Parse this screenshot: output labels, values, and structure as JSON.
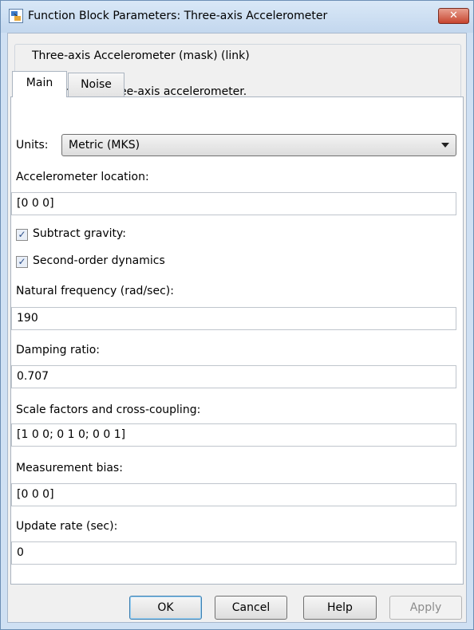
{
  "window": {
    "title": "Function Block Parameters: Three-axis Accelerometer",
    "close_label": "✕"
  },
  "block": {
    "header": "Three-axis Accelerometer (mask) (link)",
    "description": "Implement a three-axis accelerometer."
  },
  "tabs": [
    {
      "label": "Main",
      "active": true
    },
    {
      "label": "Noise",
      "active": false
    }
  ],
  "main": {
    "units_label": "Units:",
    "units_value": "Metric (MKS)",
    "accel_location_label": "Accelerometer location:",
    "accel_location_value": "[0 0 0]",
    "subtract_gravity_label": "Subtract gravity:",
    "subtract_gravity_checked": true,
    "second_order_label": "Second-order dynamics",
    "second_order_checked": true,
    "natural_freq_label": "Natural frequency (rad/sec):",
    "natural_freq_value": "190",
    "damping_label": "Damping ratio:",
    "damping_value": "0.707",
    "scale_label": "Scale factors and cross-coupling:",
    "scale_value": "[1 0 0; 0 1 0; 0 0 1]",
    "bias_label": "Measurement bias:",
    "bias_value": "[0 0 0]",
    "update_rate_label": "Update rate (sec):",
    "update_rate_value": "0"
  },
  "buttons": {
    "ok": "OK",
    "cancel": "Cancel",
    "help": "Help",
    "apply": "Apply"
  },
  "checkmark_glyph": "✓"
}
